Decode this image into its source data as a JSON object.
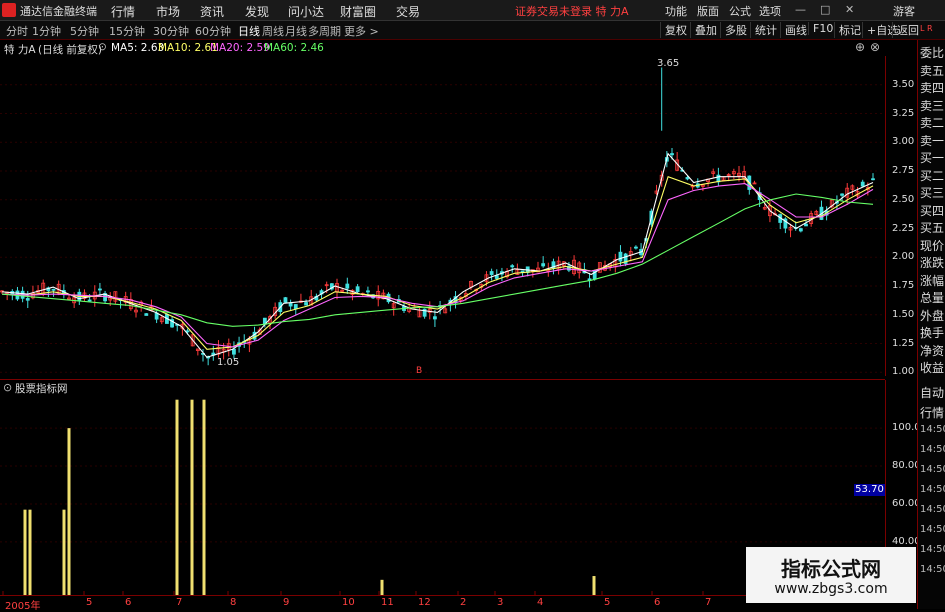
{
  "menubar": {
    "app_name": "通达信金融终端",
    "items": [
      "行情",
      "市场",
      "资讯",
      "发现",
      "问小达",
      "财富圈",
      "交易"
    ],
    "notice": "证券交易未登录  特 力A",
    "right_items": [
      "功能",
      "版面",
      "公式",
      "选项"
    ],
    "guest": "游客"
  },
  "toolbar": {
    "periods": [
      "分时",
      "1分钟",
      "5分钟",
      "15分钟",
      "30分钟",
      "60分钟",
      "日线",
      "周线",
      "月线",
      "多周期",
      "更多 >"
    ],
    "active_period": "日线",
    "buttons": [
      "复权",
      "叠加",
      "多股",
      "统计",
      "画线",
      "F10",
      "标记",
      "+自选",
      "返回"
    ]
  },
  "chart_header": {
    "stock": "特 力A",
    "mode": "(日线 前复权)",
    "ma5": "MA5: 2.63",
    "ma10": "MA10: 2.61",
    "ma20": "MA20: 2.59",
    "ma60": "MA60: 2.46"
  },
  "annotations": {
    "high": "3.65",
    "low": "1.05",
    "marker": "B"
  },
  "right_panel": {
    "corner": "L R",
    "labels": [
      "委比",
      "卖五",
      "卖四",
      "卖三",
      "卖二",
      "卖一",
      "买一",
      "买二",
      "买三",
      "买四",
      "买五",
      "现价",
      "涨跌",
      "涨幅",
      "总量",
      "外盘",
      "换手",
      "净资",
      "收益",
      "自动",
      "行情",
      "14:50",
      "14:50",
      "14:50",
      "14:50",
      "14:50",
      "14:50",
      "14:50",
      "14:50"
    ]
  },
  "sub_chart": {
    "title": "股票指标网",
    "current_label": "53.70"
  },
  "watermark": {
    "line1": "指标公式网",
    "line2": "www.zbgs3.com"
  },
  "chart_data": [
    {
      "type": "line",
      "title": "特 力A (日线 前复权)",
      "y_ticks": [
        3.5,
        3.25,
        3.0,
        2.75,
        2.5,
        2.25,
        2.0,
        1.75,
        1.5,
        1.25,
        1.0
      ],
      "ylim": [
        0.95,
        3.75
      ],
      "series": [
        {
          "name": "MA5",
          "color": "#ffffff",
          "values": [
            1.7,
            1.68,
            1.74,
            1.64,
            1.68,
            1.6,
            1.52,
            1.4,
            1.13,
            1.2,
            1.35,
            1.6,
            1.62,
            1.75,
            1.68,
            1.64,
            1.55,
            1.52,
            1.7,
            1.82,
            1.9,
            1.88,
            1.95,
            1.85,
            1.98,
            2.05,
            2.9,
            2.65,
            2.7,
            2.7,
            2.4,
            2.25,
            2.38,
            2.55,
            2.65
          ]
        },
        {
          "name": "MA10",
          "color": "#ffff66",
          "values": [
            1.68,
            1.67,
            1.7,
            1.66,
            1.66,
            1.61,
            1.55,
            1.45,
            1.2,
            1.22,
            1.32,
            1.52,
            1.58,
            1.7,
            1.68,
            1.66,
            1.58,
            1.55,
            1.65,
            1.78,
            1.86,
            1.88,
            1.92,
            1.88,
            1.94,
            2.0,
            2.7,
            2.62,
            2.66,
            2.68,
            2.45,
            2.3,
            2.36,
            2.5,
            2.62
          ]
        },
        {
          "name": "MA20",
          "color": "#ff66ff",
          "values": [
            1.68,
            1.67,
            1.68,
            1.67,
            1.66,
            1.63,
            1.57,
            1.48,
            1.25,
            1.22,
            1.28,
            1.45,
            1.55,
            1.65,
            1.66,
            1.65,
            1.6,
            1.57,
            1.62,
            1.74,
            1.82,
            1.86,
            1.9,
            1.88,
            1.92,
            1.96,
            2.5,
            2.58,
            2.62,
            2.64,
            2.5,
            2.35,
            2.35,
            2.46,
            2.59
          ]
        },
        {
          "name": "MA60",
          "color": "#66ff66",
          "values": [
            1.68,
            1.66,
            1.64,
            1.62,
            1.6,
            1.58,
            1.54,
            1.5,
            1.43,
            1.4,
            1.41,
            1.44,
            1.46,
            1.5,
            1.52,
            1.54,
            1.56,
            1.57,
            1.6,
            1.64,
            1.68,
            1.72,
            1.76,
            1.8,
            1.86,
            1.94,
            2.06,
            2.18,
            2.3,
            2.42,
            2.5,
            2.55,
            2.52,
            2.48,
            2.46
          ]
        }
      ]
    },
    {
      "type": "bar",
      "title": "股票指标网",
      "y_ticks": [
        100.0,
        80.0,
        60.0,
        40.0
      ],
      "ylim": [
        12,
        118
      ],
      "bars": [
        {
          "x": 25,
          "value": 57
        },
        {
          "x": 30,
          "value": 57
        },
        {
          "x": 64,
          "value": 57
        },
        {
          "x": 69,
          "value": 100
        },
        {
          "x": 177,
          "value": 115
        },
        {
          "x": 192,
          "value": 115
        },
        {
          "x": 204,
          "value": 115
        },
        {
          "x": 382,
          "value": 20
        },
        {
          "x": 594,
          "value": 22
        }
      ],
      "x_ticks": [
        "2005年",
        "5",
        "6",
        "7",
        "8",
        "9",
        "10",
        "11",
        "12",
        "2",
        "3",
        "4",
        "5",
        "6",
        "7"
      ]
    }
  ]
}
